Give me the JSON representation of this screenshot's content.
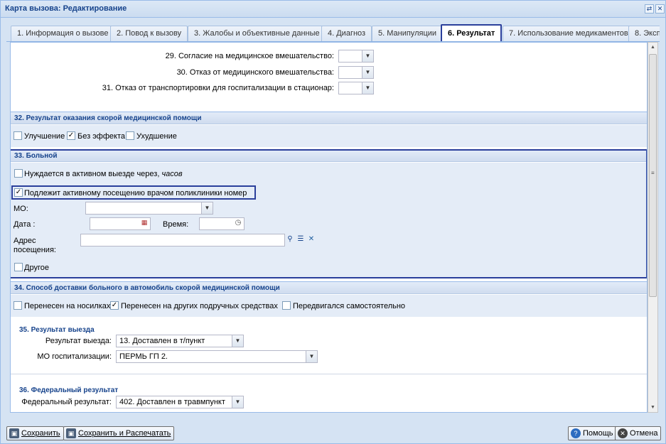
{
  "window": {
    "title": "Карта вызова: Редактирование",
    "tool_restore": "⇄",
    "tool_close": "✕"
  },
  "tabs": [
    {
      "label": "1. Информация о вызове"
    },
    {
      "label": "2. Повод к вызову"
    },
    {
      "label": "3. Жалобы и объективные данные"
    },
    {
      "label": "4. Диагноз"
    },
    {
      "label": "5. Манипуляции"
    },
    {
      "label": "6. Результат"
    },
    {
      "label": "7. Использование медикаментов"
    },
    {
      "label": "8. Эксп"
    }
  ],
  "top_fields": [
    {
      "label": "29. Согласие на медицинское вмешательство:",
      "value": ""
    },
    {
      "label": "30. Отказ от медицинского вмешательства:",
      "value": ""
    },
    {
      "label": "31. Отказ от транспортировки для госпитализации в стационар:",
      "value": ""
    }
  ],
  "section32": {
    "title": "32. Результат оказания скорой медицинской помощи",
    "options": [
      {
        "label": "Улучшение",
        "checked": false
      },
      {
        "label": "Без эффекта",
        "checked": true
      },
      {
        "label": "Ухудшение",
        "checked": false
      }
    ]
  },
  "section33": {
    "title": "33. Больной",
    "needs_visit_label": "Нуждается в активном выезде через,",
    "needs_visit_unit": "часов",
    "needs_visit_checked": false,
    "polyclinic_label": "Подлежит активному посещению врачом поликлиники номер",
    "polyclinic_checked": true,
    "mo_label": "МО:",
    "mo_value": "",
    "date_label": "Дата :",
    "date_value": "",
    "time_label": "Время:",
    "time_value": "",
    "address_label_1": "Адрес",
    "address_label_2": "посещения:",
    "address_value": "",
    "other_label": "Другое",
    "other_checked": false
  },
  "section34": {
    "title": "34. Способ доставки больного в автомобиль скорой медицинской помощи",
    "options": [
      {
        "label": "Перенесен на носилках",
        "checked": false
      },
      {
        "label": "Перенесен на других подручных средствах",
        "checked": true
      },
      {
        "label": "Передвигался самостоятельно",
        "checked": false
      }
    ]
  },
  "section35": {
    "title": "35. Результат выезда",
    "result_label": "Результат выезда:",
    "result_value": "13. Доставлен в т/пункт",
    "mo_hosp_label": "МО госпитализации:",
    "mo_hosp_value": "ПЕРМЬ ГП 2."
  },
  "section36": {
    "title": "36. Федеральный результат",
    "fed_label": "Федеральный результат:",
    "fed_value": "402. Доставлен в травмпункт"
  },
  "footer": {
    "save": "Сохранить",
    "save_print": "Сохранить и Распечатать",
    "help": "Помощь",
    "cancel": "Отмена"
  },
  "colors": {
    "accent": "#2a3f9b",
    "header_text": "#15428b"
  }
}
